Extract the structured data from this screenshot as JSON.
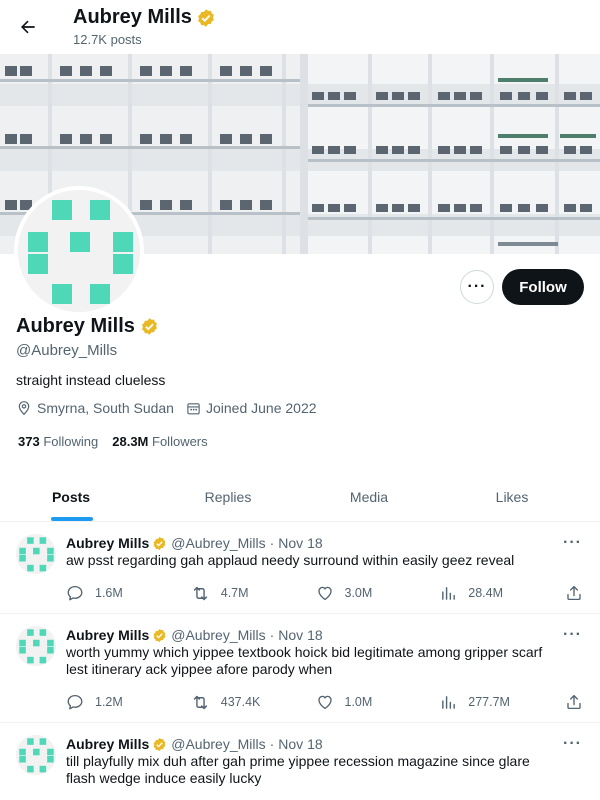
{
  "header": {
    "title": "Aubrey Mills",
    "post_count": "12.7K posts"
  },
  "profile": {
    "name": "Aubrey Mills",
    "handle": "@Aubrey_Mills",
    "bio": "straight instead clueless",
    "location": "Smyrna, South Sudan",
    "joined": "Joined June 2022",
    "following_count": "373",
    "following_label": "Following",
    "followers_count": "28.3M",
    "followers_label": "Followers",
    "follow_label": "Follow",
    "more_label": "···",
    "verified_color": "#e9b824",
    "avatar_color": "#4fd8b8"
  },
  "tabs": [
    {
      "label": "Posts",
      "active": true
    },
    {
      "label": "Replies",
      "active": false
    },
    {
      "label": "Media",
      "active": false
    },
    {
      "label": "Likes",
      "active": false
    }
  ],
  "posts": [
    {
      "name": "Aubrey Mills",
      "handle": "@Aubrey_Mills",
      "dot": "·",
      "date": "Nov 18",
      "text": "aw psst regarding gah applaud needy surround within easily geez reveal",
      "replies": "1.6M",
      "reposts": "4.7M",
      "likes": "3.0M",
      "views": "28.4M",
      "more": "···"
    },
    {
      "name": "Aubrey Mills",
      "handle": "@Aubrey_Mills",
      "dot": "·",
      "date": "Nov 18",
      "text": "worth yummy which yippee textbook hoick bid legitimate among gripper scarf lest itinerary ack yippee afore parody when",
      "replies": "1.2M",
      "reposts": "437.4K",
      "likes": "1.0M",
      "views": "277.7M",
      "more": "···"
    },
    {
      "name": "Aubrey Mills",
      "handle": "@Aubrey_Mills",
      "dot": "·",
      "date": "Nov 18",
      "text": "till playfully mix duh after gah prime yippee recession magazine since glare flash wedge induce easily lucky",
      "replies": "",
      "reposts": "",
      "likes": "",
      "views": "",
      "more": "···"
    }
  ]
}
